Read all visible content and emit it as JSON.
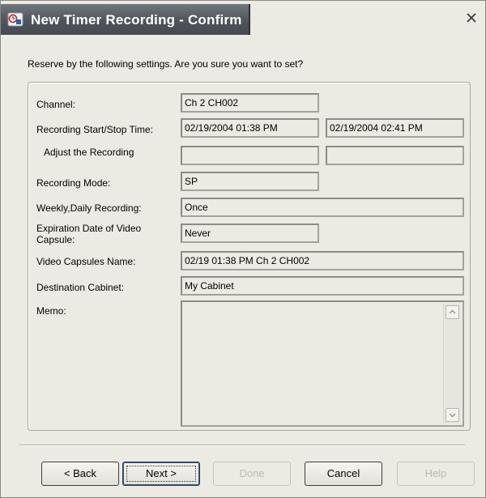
{
  "window": {
    "title": "New Timer Recording - Confirm",
    "close_symbol": "×"
  },
  "instruction": "Reserve by the following settings. Are you sure you want to set?",
  "form": {
    "channel": {
      "label": "Channel:",
      "value": "Ch 2 CH002"
    },
    "start_stop": {
      "label": "Recording Start/Stop Time:",
      "start": "02/19/2004 01:38 PM",
      "stop": "02/19/2004 02:41 PM"
    },
    "adjust": {
      "label": "Adjust the Recording",
      "start": "",
      "stop": ""
    },
    "mode": {
      "label": "Recording Mode:",
      "value": "SP"
    },
    "weekly": {
      "label": "Weekly,Daily Recording:",
      "value": "Once"
    },
    "expiration": {
      "label_line1": "Expiration Date of Video",
      "label_line2": "Capsule:",
      "value": "Never"
    },
    "capsule_name": {
      "label": "Video Capsules Name:",
      "value": "02/19 01:38 PM Ch 2 CH002"
    },
    "cabinet": {
      "label": "Destination Cabinet:",
      "value": "My Cabinet"
    },
    "memo": {
      "label": "Memo:",
      "value": ""
    }
  },
  "buttons": {
    "back": "< Back",
    "next": "Next >",
    "done": "Done",
    "cancel": "Cancel",
    "help": "Help"
  },
  "icons": {
    "title": "app-icon",
    "close": "close-icon",
    "scroll_up": "scroll-up-arrow-icon",
    "scroll_down": "scroll-down-arrow-icon"
  },
  "colors": {
    "dialog_bg": "#ecebe3",
    "title_bg": "#4f545c",
    "title_text": "#ffffff"
  }
}
